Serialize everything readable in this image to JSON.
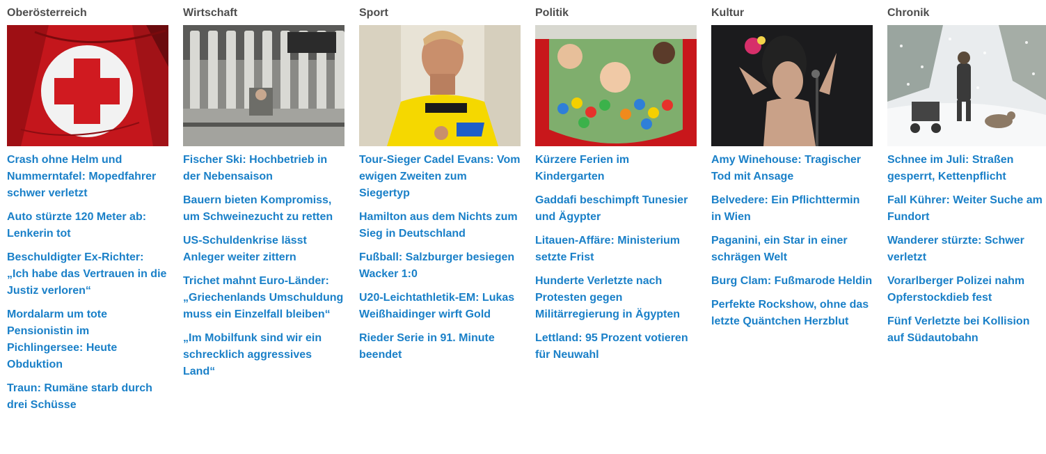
{
  "columns": [
    {
      "title": "Oberösterreich",
      "image": "red-cross-emblem",
      "headlines": [
        "Crash ohne Helm und Nummerntafel: Mopedfahrer schwer verletzt",
        "Auto stürzte 120 Meter ab: Lenkerin tot",
        "Beschuldigter Ex-Richter: „Ich habe das Vertrauen in die Justiz verloren“",
        "Mordalarm um tote Pensionistin im Pichlingersee: Heute Obduktion",
        "Traun: Rumäne starb durch drei Schüsse"
      ]
    },
    {
      "title": "Wirtschaft",
      "image": "ski-factory",
      "headlines": [
        "Fischer Ski: Hochbetrieb in der Nebensaison",
        "Bauern bieten Kompromiss, um Schweinezucht zu retten",
        "US-Schuldenkrise lässt Anleger weiter zittern",
        "Trichet mahnt Euro-Länder: „Griechenlands Umschuldung muss ein Einzelfall bleiben“",
        "„Im Mobilfunk sind wir ein schrecklich aggressives Land“"
      ]
    },
    {
      "title": "Sport",
      "image": "cyclist-yellow-jersey",
      "headlines": [
        "Tour-Sieger Cadel Evans: Vom ewigen Zweiten zum Siegertyp",
        "Hamilton aus dem Nichts zum Sieg in Deutschland",
        "Fußball: Salzburger besiegen Wacker 1:0",
        "U20-Leichtathletik-EM: Lukas Weißhaidinger wirft Gold",
        "Rieder Serie in 91. Minute beendet"
      ]
    },
    {
      "title": "Politik",
      "image": "children-ball-pit",
      "headlines": [
        "Kürzere Ferien im Kindergarten",
        "Gaddafi beschimpft Tunesier und Ägypter",
        "Litauen-Affäre: Ministerium setzte Frist",
        "Hunderte Verletzte nach Protesten gegen Militärregierung in Ägypten",
        "Lettland: 95 Prozent votieren für Neuwahl"
      ]
    },
    {
      "title": "Kultur",
      "image": "singer-on-stage",
      "headlines": [
        "Amy Winehouse: Tragischer Tod mit Ansage",
        "Belvedere: Ein Pflichttermin in Wien",
        "Paganini, ein Star in einer schrägen Welt",
        "Burg Clam: Fußmarode Heldin",
        "Perfekte Rockshow, ohne das letzte Quäntchen Herzblut"
      ]
    },
    {
      "title": "Chronik",
      "image": "snowy-street",
      "headlines": [
        "Schnee im Juli: Straßen gesperrt, Kettenpflicht",
        "Fall Kührer: Weiter Suche am Fundort",
        "Wanderer stürzte: Schwer verletzt",
        "Vorarlberger Polizei nahm Opferstockdieb fest",
        "Fünf Verletzte bei Kollision auf Südautobahn"
      ]
    }
  ]
}
